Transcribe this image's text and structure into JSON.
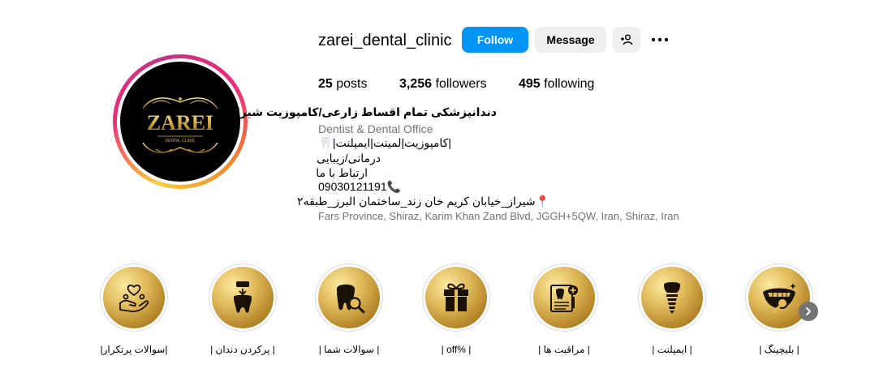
{
  "profile": {
    "username": "zarei_dental_clinic",
    "follow_label": "Follow",
    "message_label": "Message",
    "stats": {
      "posts_count": "25",
      "posts_label": "posts",
      "followers_count": "3,256",
      "followers_label": "followers",
      "following_count": "495",
      "following_label": "following"
    },
    "avatar": {
      "brand_text": "ZAREI",
      "sub_text": "DENTAL CLINIC"
    },
    "bio": {
      "name": "دندانپزشکی تمام اقساط زارعی/کامپوزیت شیراز",
      "category": "Dentist & Dental Office",
      "line1": "|کامپوزیت|لمینت|ایمپلنت|🦷",
      "line2": "درمانی/زیبایی",
      "line3": "ارتباط با ما",
      "phone": "09030121191📞",
      "address": "📍شیراز_خیابان کریم خان زند_ساختمان البرز_طبقه۲",
      "location": "Fars Province, Shiraz, Karim Khan Zand Blvd, JGGH+5QW, Iran, Shiraz, Iran"
    }
  },
  "highlights": [
    {
      "label": "|سوالات پرتکرار|",
      "icon": "hands-heart-icon"
    },
    {
      "label": "| پرکردن دندان |",
      "icon": "tooth-filling-icon"
    },
    {
      "label": "| سوالات شما |",
      "icon": "tooth-search-icon"
    },
    {
      "label": "| off% |",
      "icon": "gift-icon"
    },
    {
      "label": "| مراقبت ها |",
      "icon": "tooth-clipboard-icon"
    },
    {
      "label": "| ایمپلنت |",
      "icon": "implant-icon"
    },
    {
      "label": "| بلیچینگ |",
      "icon": "smile-teeth-icon"
    }
  ],
  "colors": {
    "follow_button": "#0095f6",
    "gold": "#d4a942",
    "text_secondary": "#737373"
  }
}
